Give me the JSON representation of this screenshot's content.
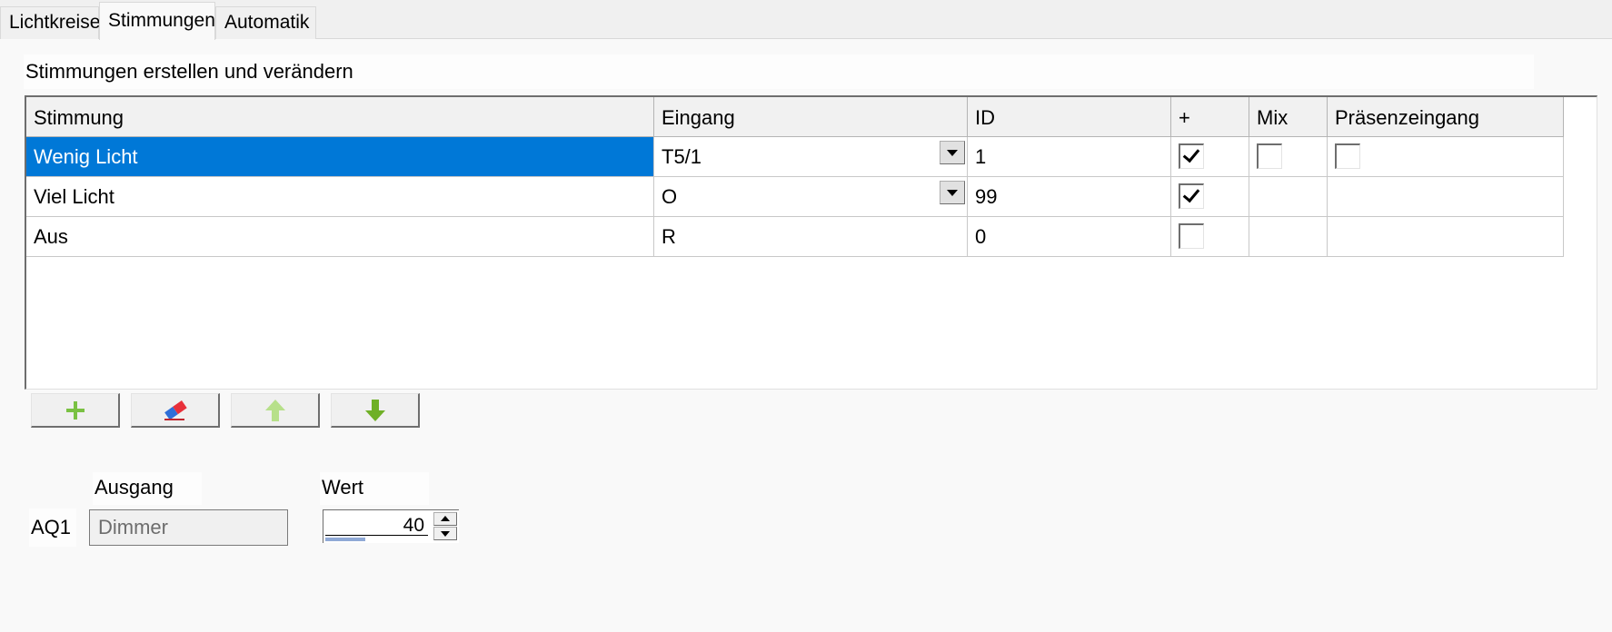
{
  "tabs": [
    {
      "label": "Lichtkreise",
      "active": false
    },
    {
      "label": "Stimmungen",
      "active": true
    },
    {
      "label": "Automatik",
      "active": false
    }
  ],
  "panel_title": "Stimmungen erstellen und verändern",
  "grid": {
    "columns": [
      "Stimmung",
      "Eingang",
      "ID",
      "+",
      "Mix",
      "Präsenzeingang"
    ],
    "rows": [
      {
        "stimmung": "Wenig Licht",
        "eingang": "T5/1",
        "id": "1",
        "plus": true,
        "mix": false,
        "praesenz": false,
        "selected": true
      },
      {
        "stimmung": "Viel Licht",
        "eingang": "O",
        "id": "99",
        "plus": true
      },
      {
        "stimmung": "Aus",
        "eingang": "R",
        "id": "0",
        "plus": false
      }
    ]
  },
  "toolbar": {
    "add_icon": "plus-icon",
    "erase_icon": "eraser-icon",
    "up_icon": "arrow-up-icon",
    "down_icon": "arrow-down-icon"
  },
  "output": {
    "ausgang_label": "Ausgang",
    "wert_label": "Wert",
    "channel": "AQ1",
    "ausgang_value": "Dimmer",
    "wert_value": "40"
  },
  "colors": {
    "selection": "#0078d7",
    "add_green": "#7ac143",
    "arrow_up": "#b7e08a",
    "arrow_down": "#6fb026",
    "eraser_red": "#e8303a",
    "eraser_blue": "#2f6fd8"
  }
}
